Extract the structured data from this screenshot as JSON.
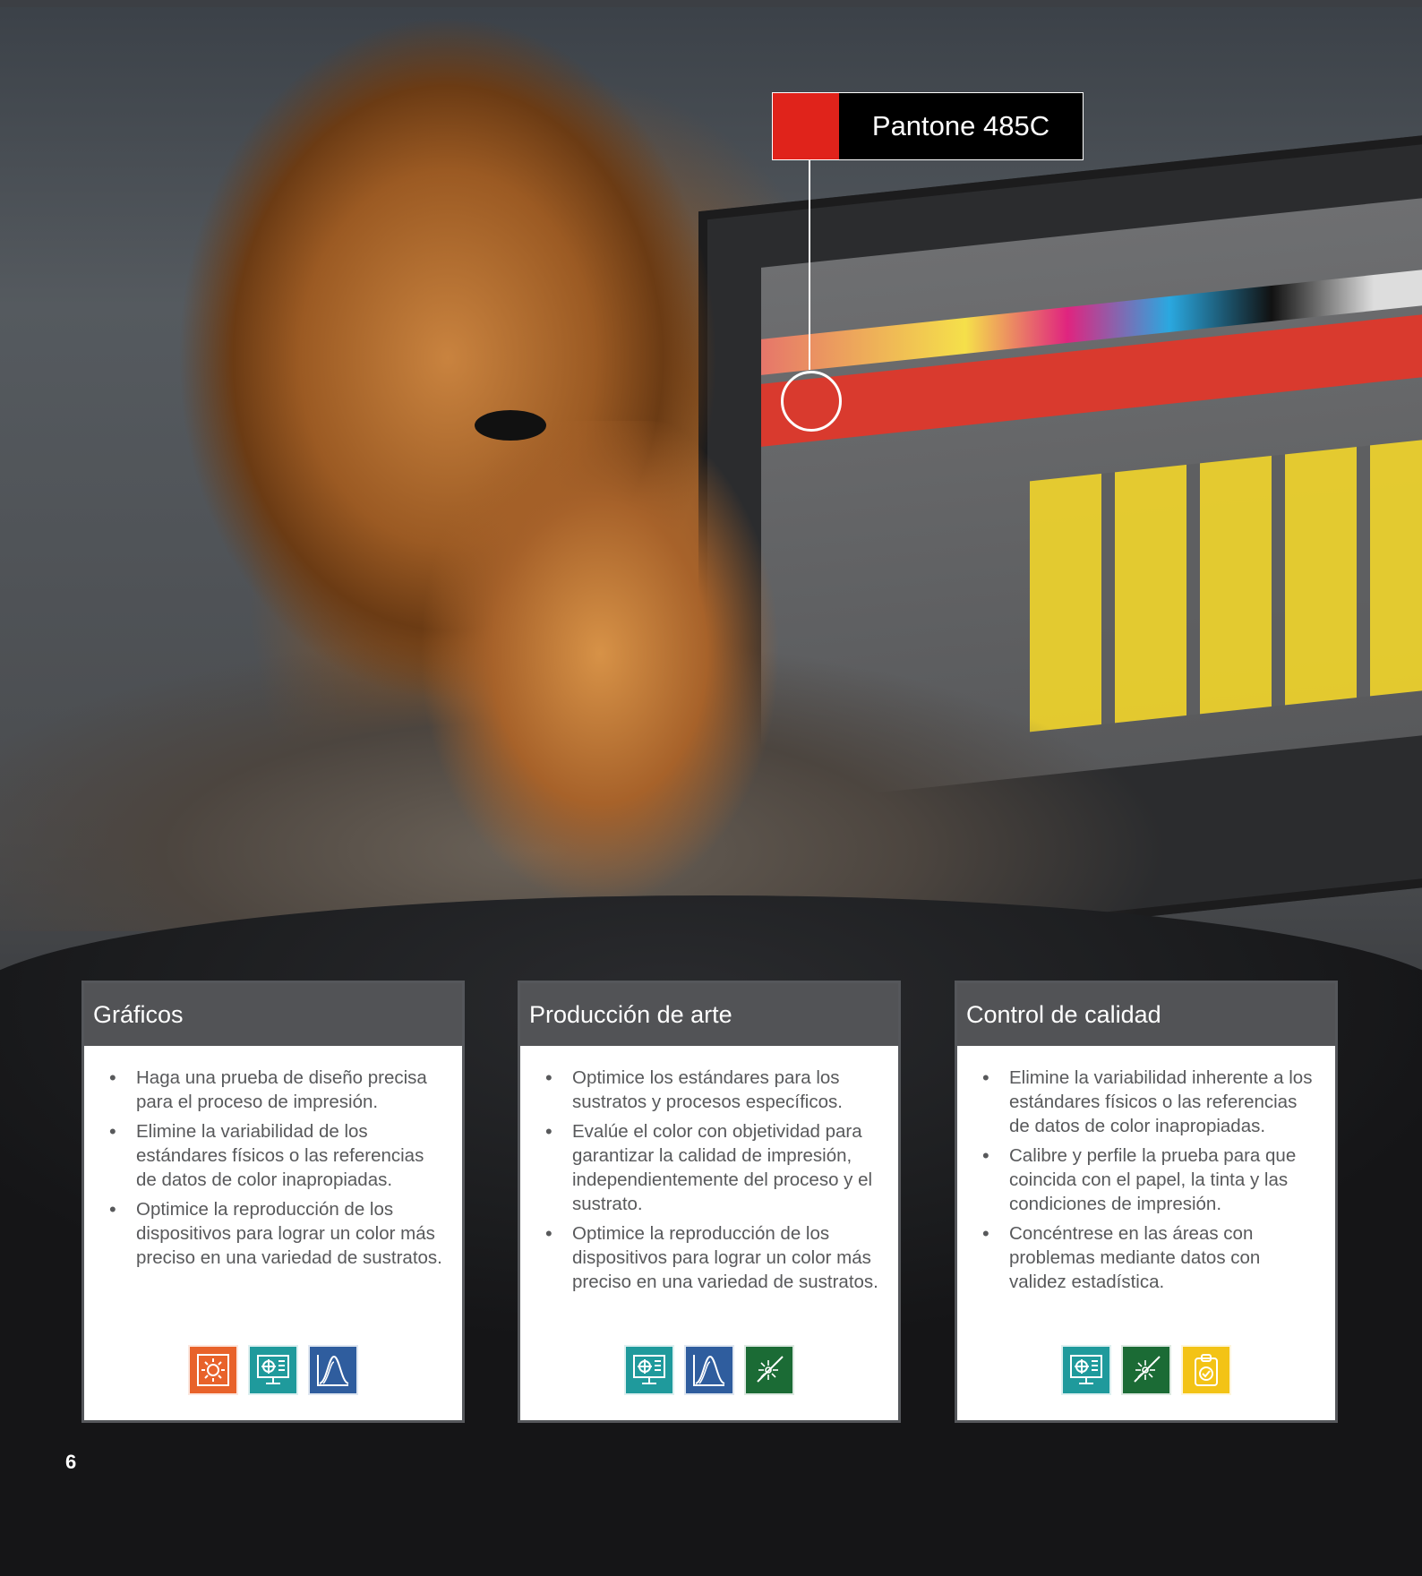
{
  "callout": {
    "label": "Pantone 485C",
    "swatch_color": "#e0231b"
  },
  "cards": [
    {
      "title": "Gráficos",
      "bullets": [
        "Haga una prueba de diseño precisa para el proceso de impresión.",
        "Elimine la variabilidad de los estándares físicos o las referencias de datos de color inapropiadas.",
        "Optimice la reproducción de los dispositivos para lograr un color más preciso en una variedad de sustratos."
      ],
      "icons": [
        "light-booth-icon",
        "monitor-calibration-icon",
        "spectral-curve-icon"
      ]
    },
    {
      "title": "Producción de arte",
      "bullets": [
        "Optimice los estándares para los sustratos y procesos específicos.",
        "Evalúe el color con objetividad para garantizar la calidad de impresión, independientemente del proceso y el sustrato.",
        "Optimice la reproducción de los dispositivos para lograr un color más preciso en una variedad de sustratos."
      ],
      "icons": [
        "monitor-calibration-icon",
        "spectral-curve-icon",
        "light-measurement-icon"
      ]
    },
    {
      "title": "Control de calidad",
      "bullets": [
        "Elimine la variabilidad inherente a los estándares físicos o las referencias de datos de color inapropiadas.",
        "Calibre y perfile la prueba para que coincida con el papel, la tinta y las condiciones de impresión.",
        "Concéntrese en las áreas con problemas mediante datos con validez estadística."
      ],
      "icons": [
        "monitor-calibration-icon",
        "light-measurement-icon",
        "clipboard-check-icon"
      ]
    }
  ],
  "icon_colors": {
    "light-booth-icon": "#e8622a",
    "monitor-calibration-icon": "#1f9a9c",
    "spectral-curve-icon": "#2f5d9e",
    "light-measurement-icon": "#1b6b35",
    "clipboard-check-icon": "#f3c316"
  },
  "page_number": "6"
}
